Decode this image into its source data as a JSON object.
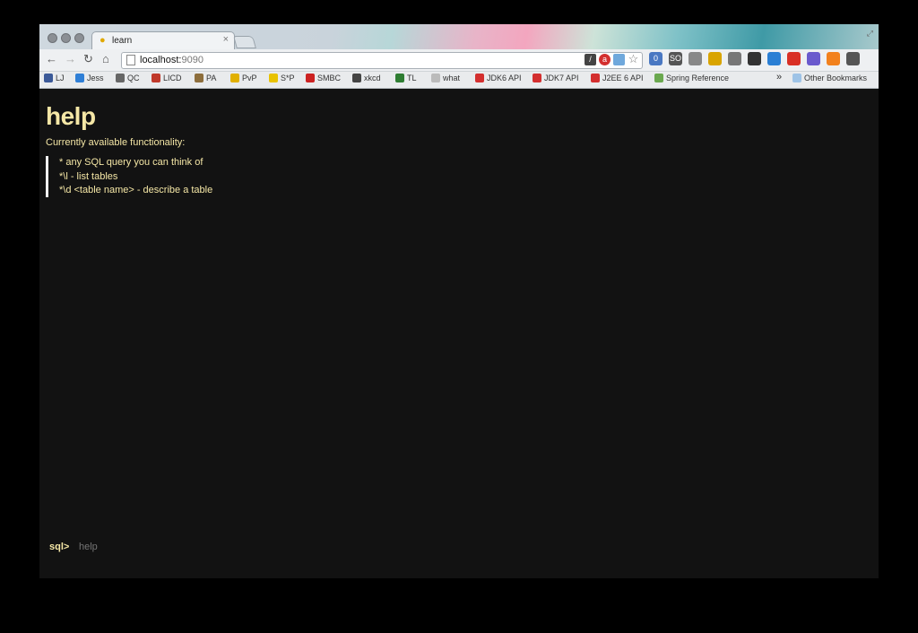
{
  "browser": {
    "tab": {
      "title": "learn",
      "favicon": "lightbulb-icon"
    },
    "address_bar": {
      "host": "localhost:",
      "port": "9090"
    },
    "bookmarks": [
      {
        "label": "LJ",
        "icon": "user-icon",
        "color": "#3b5998"
      },
      {
        "label": "Jess",
        "icon": "butterfly-icon",
        "color": "#2f7fd6"
      },
      {
        "label": "QC",
        "icon": "qc-icon",
        "color": "#666666"
      },
      {
        "label": "LICD",
        "icon": "licd-icon",
        "color": "#c0392b"
      },
      {
        "label": "PA",
        "icon": "pa-icon",
        "color": "#8d6e3c"
      },
      {
        "label": "PvP",
        "icon": "pvp-icon",
        "color": "#e1b000"
      },
      {
        "label": "S*P",
        "icon": "smiley-icon",
        "color": "#e8c200"
      },
      {
        "label": "SMBC",
        "icon": "smbc-icon",
        "color": "#cc2222"
      },
      {
        "label": "xkcd",
        "icon": "xkcd-icon",
        "color": "#444444"
      },
      {
        "label": "TL",
        "icon": "tl-icon",
        "color": "#2e7d32"
      },
      {
        "label": "what",
        "icon": "blank-icon",
        "color": "#bbbbbb"
      },
      {
        "label": "JDK6 API",
        "icon": "oracle-icon",
        "color": "#d32f2f"
      },
      {
        "label": "JDK7 API",
        "icon": "oracle-icon",
        "color": "#d32f2f"
      },
      {
        "label": "J2EE 6 API",
        "icon": "oracle-icon",
        "color": "#d32f2f"
      },
      {
        "label": "Spring Reference",
        "icon": "leaf-icon",
        "color": "#6aa84f"
      }
    ],
    "overflow": "»",
    "other_bookmarks": "Other Bookmarks",
    "extensions": [
      {
        "name": "badge-zero-icon",
        "text": "0",
        "color": "#4a78c2"
      },
      {
        "name": "so-icon",
        "text": "SO",
        "color": "#555555"
      },
      {
        "name": "calendar-icon",
        "text": "",
        "color": "#888888"
      },
      {
        "name": "bell-icon",
        "text": "",
        "color": "#d9a400"
      },
      {
        "name": "clipboard-icon",
        "text": "",
        "color": "#777777"
      },
      {
        "name": "phone-icon",
        "text": "",
        "color": "#333333"
      },
      {
        "name": "mail-icon",
        "text": "",
        "color": "#2a7fd4"
      },
      {
        "name": "stop-icon",
        "text": "",
        "color": "#d93025"
      },
      {
        "name": "radar-icon",
        "text": "",
        "color": "#6a5acd"
      },
      {
        "name": "rss-icon",
        "text": "",
        "color": "#f2811d"
      },
      {
        "name": "wrench-icon",
        "text": "",
        "color": "#555555"
      }
    ]
  },
  "page": {
    "heading": "help",
    "intro": "Currently available functionality:",
    "items": [
      "* any SQL query you can think of",
      "*\\l - list tables",
      "*\\d <table name> - describe a table"
    ],
    "prompt_label": "sql>",
    "input_placeholder": "help"
  }
}
